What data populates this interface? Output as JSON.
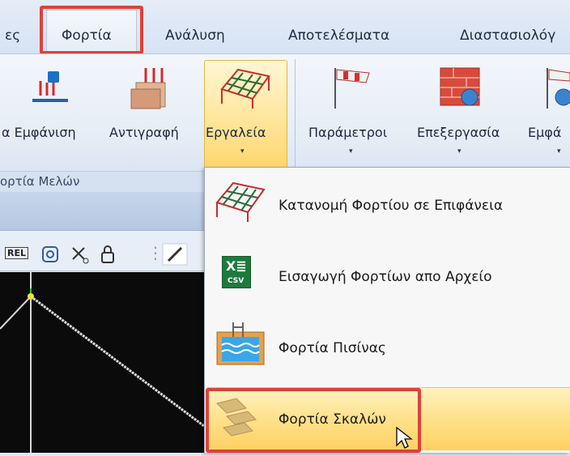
{
  "menubar": {
    "tabs": [
      {
        "label": "ες",
        "active": false
      },
      {
        "label": "Φορτία",
        "active": true
      },
      {
        "label": "Ανάλυση",
        "active": false
      },
      {
        "label": "Αποτελέσματα",
        "active": false
      },
      {
        "label": "Διαστασιολόγ",
        "active": false
      }
    ]
  },
  "ribbon": {
    "buttons": [
      {
        "label": "α Εμφάνιση",
        "icon": "load-display-icon",
        "has_dropdown": false
      },
      {
        "label": "Αντιγραφή",
        "icon": "copy-load-icon",
        "has_dropdown": false
      },
      {
        "label": "Εργαλεία",
        "icon": "tools-grid-icon",
        "has_dropdown": true,
        "pressed": true
      },
      {
        "label": "Παράμετροι",
        "icon": "parameters-windsock-icon",
        "has_dropdown": true
      },
      {
        "label": "Επεξεργασία",
        "icon": "edit-brick-icon",
        "has_dropdown": true
      },
      {
        "label": "Εμφά",
        "icon": "display-icon",
        "has_dropdown": true
      }
    ],
    "group_label": "ορτία Μελών",
    "dropdown_glyph": "▾"
  },
  "toolbar": {
    "rel_label": "REL",
    "icons": [
      "rel-icon",
      "node-icon",
      "cross-icon",
      "lock-icon",
      "pencil-icon"
    ]
  },
  "dropdown": {
    "items": [
      {
        "label": "Κατανομή Φορτίου σε Επιφάνεια",
        "icon": "surface-load-grid-icon"
      },
      {
        "label": "Εισαγωγή Φορτίων απο Αρχείο",
        "icon": "csv-import-icon",
        "icon_text": "X≣",
        "icon_subtext": "CSV"
      },
      {
        "label": "Φορτία Πισίνας",
        "icon": "pool-load-icon"
      },
      {
        "label": "Φορτία Σκαλών",
        "icon": "stairs-load-icon",
        "hovered": true
      }
    ]
  },
  "colors": {
    "highlight_red": "#e0403a",
    "hover_gold": "#ffd062",
    "ribbon_bg": "#e6edf6"
  }
}
